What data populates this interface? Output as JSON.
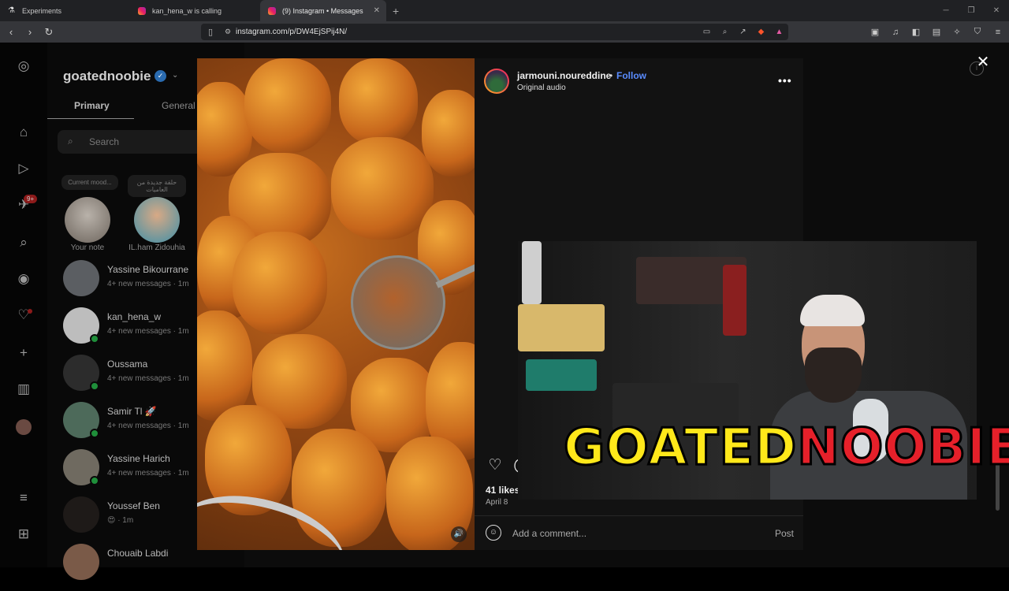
{
  "browser": {
    "tabs": [
      {
        "title": "Experiments"
      },
      {
        "title": "kan_hena_w is calling"
      },
      {
        "title": "(9) Instagram • Messages"
      }
    ],
    "url": "instagram.com/p/DW4EjSPij4N/"
  },
  "inbox": {
    "username": "goatednoobie",
    "tabs": {
      "primary": "Primary",
      "general": "General"
    },
    "search_placeholder": "Search",
    "notes": [
      {
        "bubble": "Current mood...",
        "label": "Your note"
      },
      {
        "bubble": "حلقة جديدة من العاميات",
        "label": "IL.ham Zidouhia"
      }
    ],
    "conversations": [
      {
        "name": "Yassine Bikourrane",
        "sub": "4+ new messages · 1m"
      },
      {
        "name": "kan_hena_w",
        "sub": "4+ new messages · 1m"
      },
      {
        "name": "Oussama",
        "sub": "4+ new messages · 1m"
      },
      {
        "name": "Samir Tl 🚀",
        "sub": "4+ new messages · 1m"
      },
      {
        "name": "Yassine Harich",
        "sub": "4+ new messages · 1m"
      },
      {
        "name": "Youssef Ben",
        "sub": "😍 · 1m"
      },
      {
        "name": "Chouaib Labdi",
        "sub": ""
      }
    ],
    "rail_badge": "9+"
  },
  "post": {
    "author": "jarmouni.noureddine",
    "separator": "•",
    "follow": "Follow",
    "audio": "Original audio",
    "likes": "41 likes",
    "date": "April 8",
    "comment_placeholder": "Add a comment...",
    "post_button": "Post"
  },
  "overlay": {
    "logo_part1": "GOATED",
    "logo_part2": "NOOBIE"
  },
  "icons": [
    "back-icon",
    "forward-icon",
    "reload-icon",
    "bookmark-icon",
    "instagram-icon",
    "home-icon",
    "reels-icon",
    "messenger-icon",
    "search-icon",
    "explore-icon",
    "heart-icon",
    "create-icon",
    "dashboard-icon",
    "menu-icon",
    "meta-icon",
    "like-icon",
    "comment-icon",
    "share-icon",
    "emoji-icon",
    "volume-icon",
    "close-icon"
  ]
}
